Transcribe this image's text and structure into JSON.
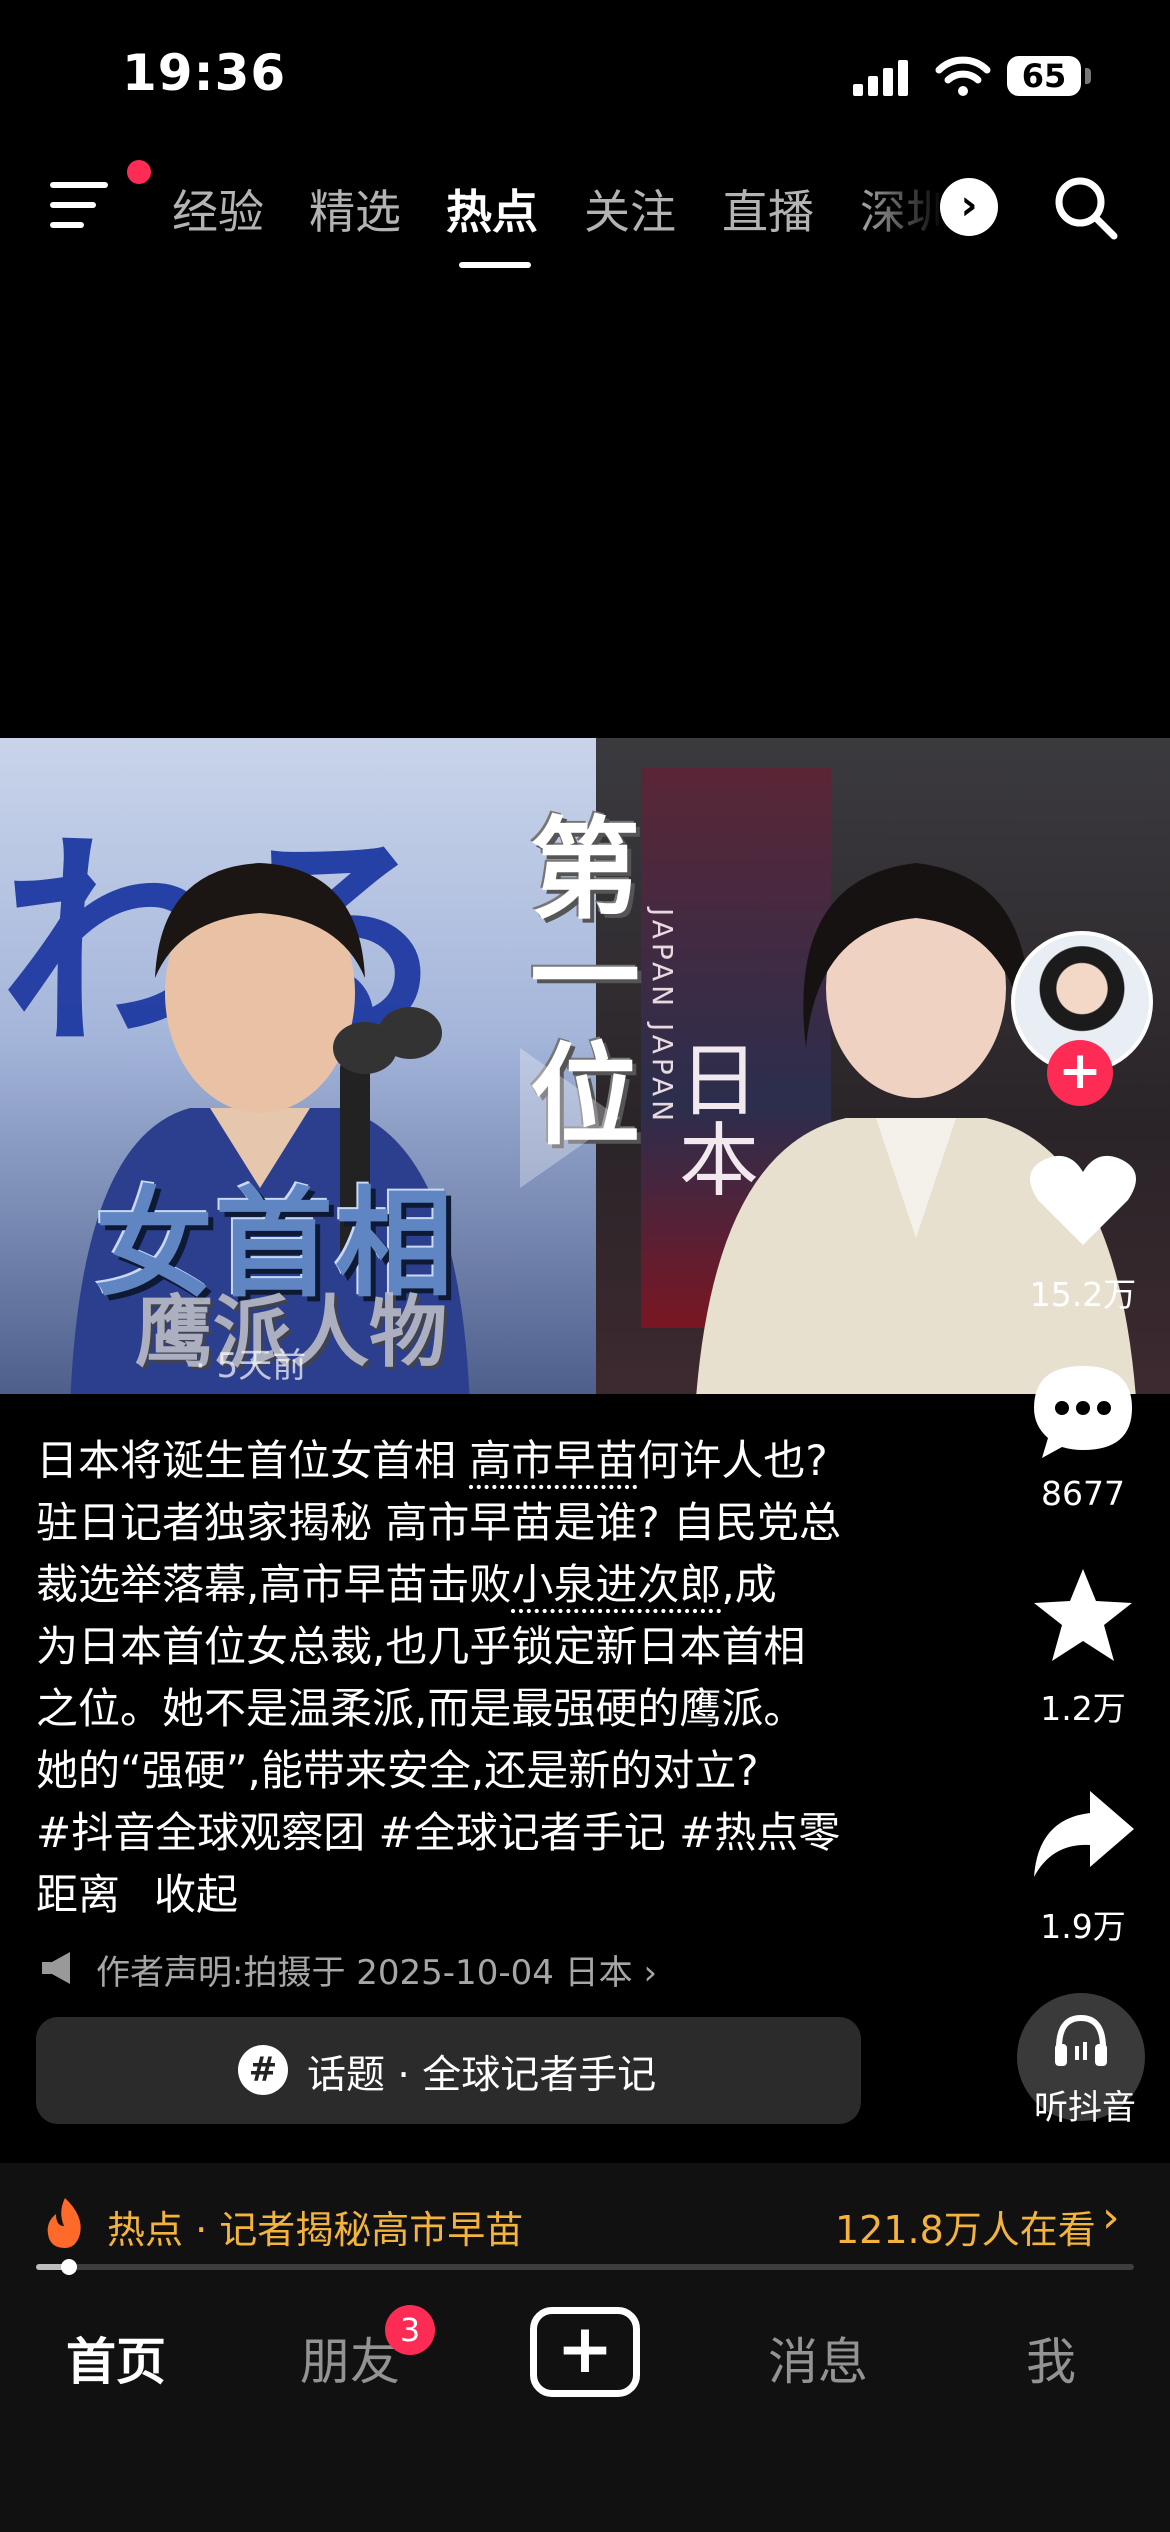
{
  "status_bar": {
    "time": "19:36",
    "battery": "65"
  },
  "top_nav": {
    "tabs": [
      "经验",
      "精选",
      "热点",
      "关注",
      "直播",
      "深圳"
    ],
    "active_tab": "热点"
  },
  "video": {
    "overlay_lines": [
      "第",
      "一",
      "位"
    ],
    "overlay_woman_pm": "女首相",
    "overlay_hawk": "鹰派人物",
    "poster_text": "JAPAN JAPAN",
    "poster_big": "日本",
    "background_letters": "わる",
    "age": "· 5天前"
  },
  "actions": {
    "likes": "15.2万",
    "comments": "8677",
    "favorites": "1.2万",
    "shares": "1.9万",
    "listen": "听抖音"
  },
  "caption": {
    "l1a": "日本将诞生首位女首相 ",
    "l1b": "高市早苗",
    "l1c": "何许人也?",
    "l2": "驻日记者独家揭秘 高市早苗是谁? 自民党总",
    "l3a": "裁选举落幕,高市早苗击败",
    "l3b": "小泉进次郎",
    "l3c": ",成",
    "l4": "为日本首位女总裁,也几乎锁定新日本首相",
    "l5": "之位。她不是温柔派,而是最强硬的鹰派。",
    "l6": "她的“强硬”,能带来安全,还是新的对立?",
    "l7": "#抖音全球观察团  #全球记者手记  #热点零",
    "l8": "距离",
    "collapse": "收起"
  },
  "declaration": "作者声明:拍摄于 2025-10-04 日本 ›",
  "topic": {
    "hash": "#",
    "text": "话题 · 全球记者手记"
  },
  "hot": {
    "title": "热点 · 记者揭秘高市早苗",
    "count": "121.8万人在看",
    "arrow": "›"
  },
  "progress": 0.03,
  "bottom_nav": {
    "home": "首页",
    "friends": "朋友",
    "friends_badge": "3",
    "create": "+",
    "messages": "消息",
    "me": "我"
  },
  "colors": {
    "accent_red": "#fe2c55",
    "hot_gold": "#f3b33c"
  }
}
